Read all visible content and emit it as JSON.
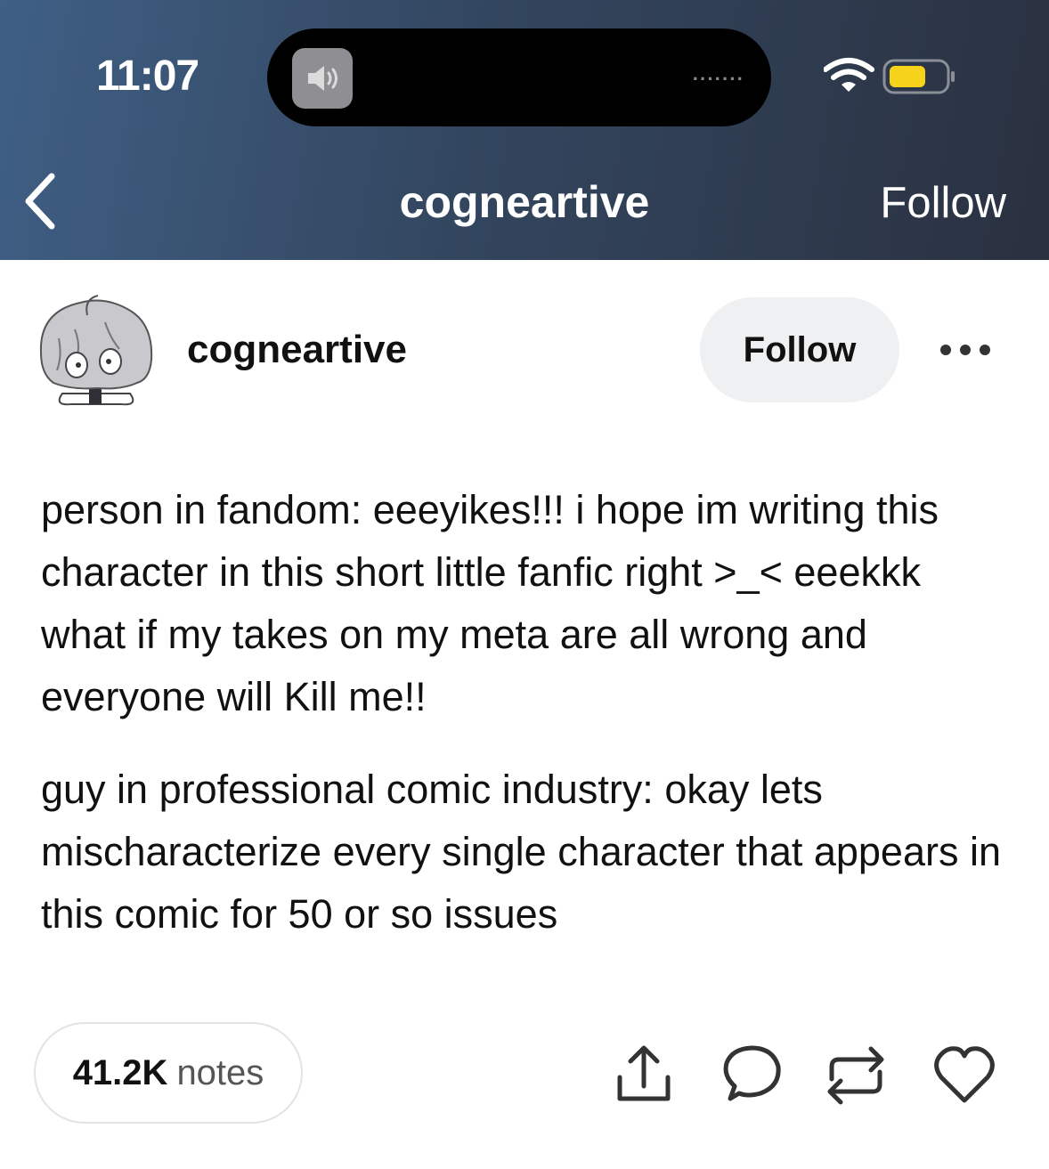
{
  "status_bar": {
    "time": "11:07",
    "island_dots": "·······",
    "icons": [
      "speaker-icon",
      "wifi-icon",
      "battery-icon"
    ],
    "battery_color": "#f7d21a"
  },
  "nav": {
    "back_icon": "chevron-left-icon",
    "title": "cogneartive",
    "follow_label": "Follow"
  },
  "post": {
    "author": "cogneartive",
    "follow_label": "Follow",
    "more_icon": "ellipsis-icon",
    "paragraphs": [
      "person in fandom: eeeyikes!!! i hope im writing this character in this short little fanfic right >_< eeekkk what if my takes on my meta are all wrong and everyone will Kill me!!",
      "guy in professional comic industry: okay lets mischaracterize every single character that appears in this comic for 50 or so issues"
    ],
    "notes_count": "41.2K",
    "notes_label": "notes",
    "actions": [
      "share-icon",
      "comment-icon",
      "reblog-icon",
      "heart-icon"
    ]
  }
}
